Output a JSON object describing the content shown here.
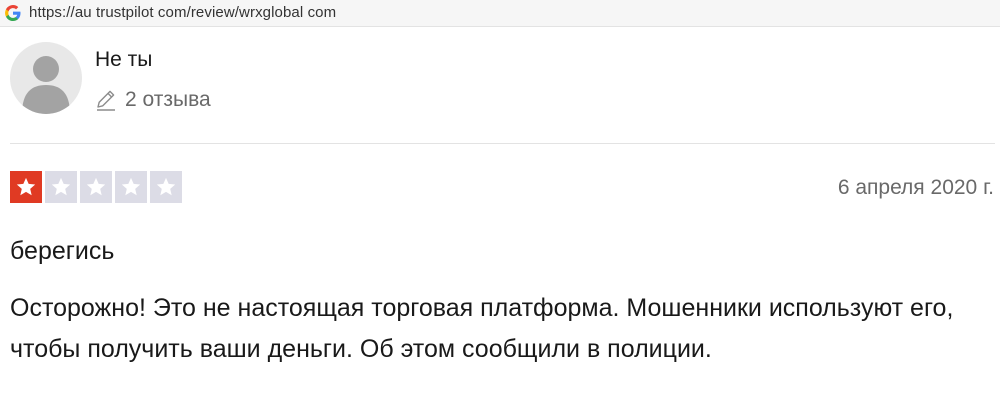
{
  "browser": {
    "url": "https://au trustpilot com/review/wrxglobal com",
    "icon": "google-g-icon"
  },
  "review": {
    "author": {
      "name": "Не ты",
      "reviews_count": "2 отзыва",
      "avatar_icon": "user-silhouette-icon"
    },
    "rating": {
      "value": 1,
      "max": 5,
      "filled_color": "#e03a23",
      "empty_color": "#dcdce6"
    },
    "date": "6 апреля 2020 г.",
    "title": "берегись",
    "body": "Осторожно! Это не настоящая торговая платформа. Мошенники используют его, чтобы получить ваши деньги. Об этом сообщили в полиции."
  }
}
